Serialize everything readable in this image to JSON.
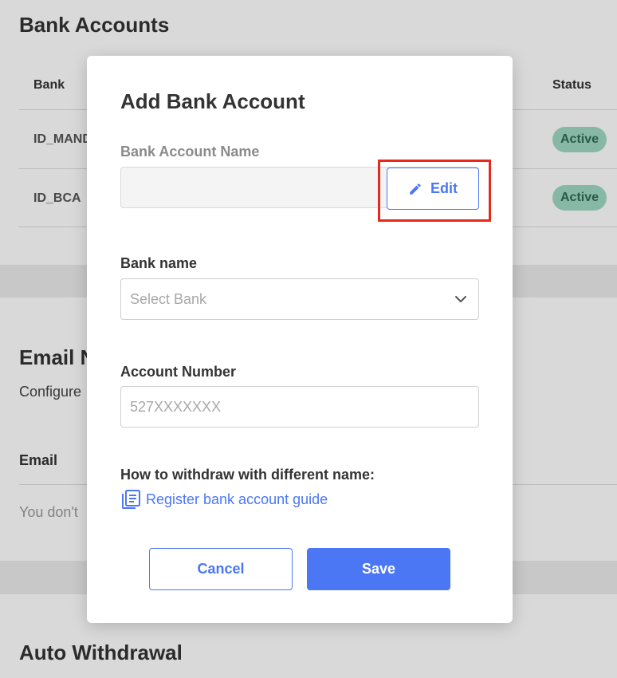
{
  "background": {
    "bank_accounts": {
      "title": "Bank Accounts",
      "col_bank": "Bank",
      "col_status": "Status",
      "rows": [
        {
          "bank": "ID_MAND",
          "status": "Active"
        },
        {
          "bank": "ID_BCA",
          "status": "Active"
        }
      ]
    },
    "email": {
      "title": "Email N",
      "subtitle": "Configure",
      "col_email": "Email",
      "empty_text": "You don't"
    },
    "auto_withdrawal": {
      "title": "Auto Withdrawal"
    }
  },
  "modal": {
    "title": "Add Bank Account",
    "account_name": {
      "label": "Bank Account Name",
      "value": "",
      "edit_label": "Edit"
    },
    "bank_name": {
      "label": "Bank name",
      "placeholder": "Select Bank"
    },
    "account_number": {
      "label": "Account Number",
      "placeholder": "527XXXXXXX",
      "value": ""
    },
    "guide": {
      "heading": "How to withdraw with different name:",
      "link_label": "Register bank account guide"
    },
    "cancel_label": "Cancel",
    "save_label": "Save"
  },
  "colors": {
    "accent": "#4b77f5",
    "highlight": "#e8281a",
    "badge_bg": "#9fd9c4"
  },
  "icons": {
    "edit": "pencil-icon",
    "select": "chevron-down-icon",
    "guide": "document-list-icon"
  }
}
